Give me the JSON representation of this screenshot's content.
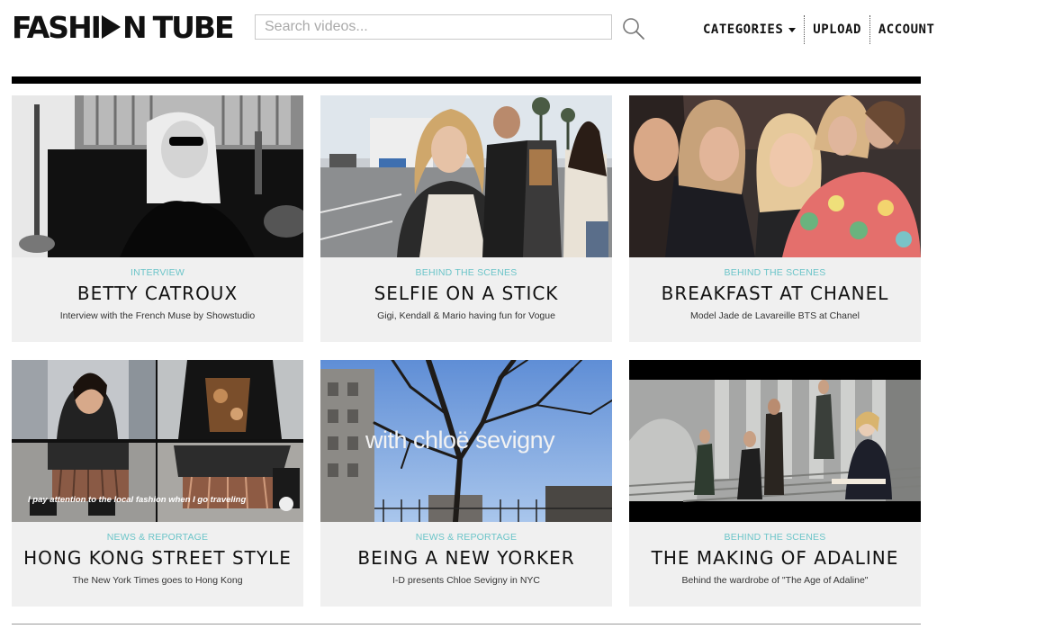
{
  "header": {
    "logo_left": "FASHI",
    "logo_right": "N",
    "logo_tube": "TUBE",
    "search_placeholder": "Search videos...",
    "search_icon": "search-icon",
    "nav": {
      "categories": "CATEGORIES",
      "upload": "UPLOAD",
      "account": "ACCOUNT"
    }
  },
  "videos": [
    {
      "category": "INTERVIEW",
      "title": "BETTY CATROUX",
      "description": "Interview with the French Muse by Showstudio"
    },
    {
      "category": "BEHIND THE SCENES",
      "title": "SELFIE ON A STICK",
      "description": "Gigi, Kendall & Mario having fun for Vogue"
    },
    {
      "category": "BEHIND THE SCENES",
      "title": "BREAKFAST AT CHANEL",
      "description": "Model Jade de Lavareille BTS at Chanel"
    },
    {
      "category": "NEWS & REPORTAGE",
      "title": "HONG KONG STREET STYLE",
      "description": "The New York Times goes to Hong Kong",
      "overlay": "I pay attention to the local fashion when I go traveling"
    },
    {
      "category": "NEWS & REPORTAGE",
      "title": "BEING A NEW YORKER",
      "description": "I-D presents Chloe Sevigny in NYC",
      "overlay": "with chloë sevigny"
    },
    {
      "category": "BEHIND THE SCENES",
      "title": "THE MAKING OF ADALINE",
      "description": "Behind the wardrobe of \"The Age of Adaline\""
    }
  ],
  "colors": {
    "accent": "#6cc5c9",
    "card_bg": "#f0f0f0",
    "text": "#111111"
  }
}
